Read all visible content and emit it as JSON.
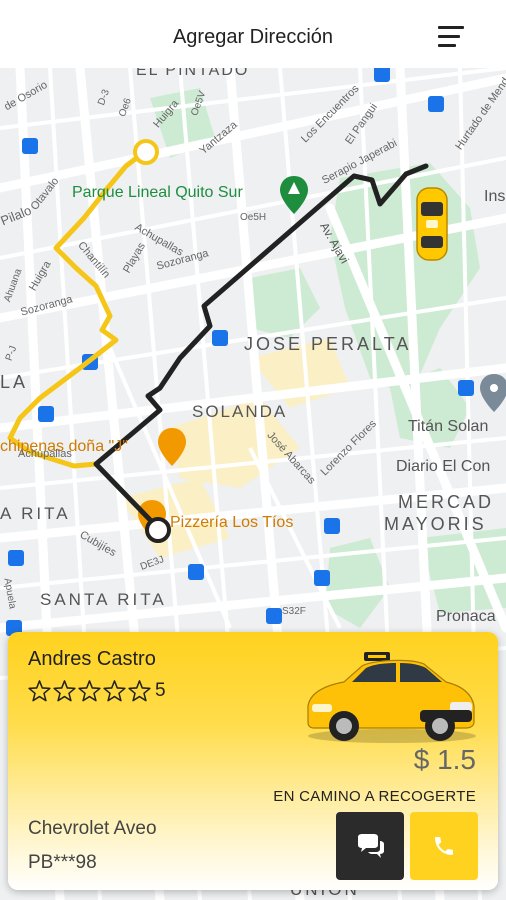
{
  "header": {
    "title": "Agregar Dirección",
    "menu_icon": "hamburger-menu-icon"
  },
  "map": {
    "neighborhoods": {
      "el_pintado": "EL PINTADO",
      "jose_peralta": "JOSE PERALTA",
      "solanda": "SOLANDA",
      "santa_rita_1": "A RITA",
      "santa_rita_2": "SANTA RITA",
      "mercado": "MERCAD",
      "mayoris": "MAYORIS",
      "la": "LA",
      "union": "UNION"
    },
    "places": {
      "parque": "Parque Lineal Quito Sur",
      "chipenas": "chipenas doña \"J\"",
      "pizzeria": "Pizzería Los Tíos",
      "titan": "Titán Solan",
      "diario": "Diario El Con",
      "pronaca": "Pronaca",
      "ins": "Ins"
    },
    "streets": {
      "pilalo": "Pilalo",
      "otavalo": "Otavalo",
      "huigra_1": "Huigra",
      "huigra_2": "Huigra",
      "oe6": "Oe6",
      "d3": "D-3",
      "oe5v": "Oe5V",
      "yantzaza": "Yantzaza",
      "los_encuentros": "Los Encuentros",
      "el_pangui": "El Pangui",
      "serapio": "Serapio Japerabi",
      "hurtado": "Hurtado de Mend",
      "de_osorio": "de Osorio",
      "achupallas_1": "Achupallas",
      "achupallas_2": "Achupallas",
      "chantilin": "Chantilín",
      "playas": "Playas",
      "sozoranga_1": "Sozoranga",
      "sozoranga_2": "Sozoranga",
      "oe5h": "Oe5H",
      "av_ajavi": "Av. Ajavi",
      "jose_abarcas": "José Abarcas",
      "lorenzo_flores": "Lorenzo Flores",
      "cubijies": "Cubijíes",
      "de3j": "DE3J",
      "s32f": "S32F",
      "apuela": "Apuela",
      "ahuana": "Ahuana",
      "pj": "P-J"
    }
  },
  "ride": {
    "driver_name": "Andres Castro",
    "rating_value": "5",
    "rating_stars": 5,
    "price": "$ 1.5",
    "status": "EN CAMINO A RECOGERTE",
    "car_model": "Chevrolet Aveo",
    "plate": "PB***98",
    "chat_icon": "chat-bubbles-icon",
    "call_icon": "phone-icon"
  },
  "colors": {
    "accent": "#FFD21F",
    "route_dark": "#222222",
    "route_yellow": "#F5C518",
    "dark_button": "#2B2B2B"
  }
}
